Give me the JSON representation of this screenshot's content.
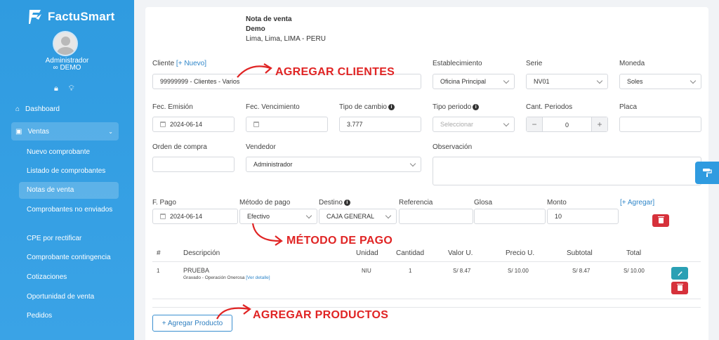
{
  "app": {
    "brand": "FactuSmart"
  },
  "user": {
    "name": "Administrador",
    "role": "DEMO"
  },
  "sidebar": {
    "dashboard": "Dashboard",
    "ventas": "Ventas",
    "sub": [
      "Nuevo comprobante",
      "Listado de comprobantes",
      "Notas de venta",
      "Comprobantes no enviados",
      "CPE por rectificar",
      "Comprobante contingencia",
      "Cotizaciones",
      "Oportunidad de venta",
      "Pedidos"
    ],
    "active": "Notas de venta"
  },
  "company": {
    "doc_type": "Nota de venta",
    "name": "Demo",
    "address": "Lima, Lima, LIMA - PERU"
  },
  "form": {
    "cliente_label": "Cliente",
    "cliente_new": "[+ Nuevo]",
    "cliente_value": "99999999 - Clientes - Varios",
    "establecimiento_label": "Establecimiento",
    "establecimiento_value": "Oficina Principal",
    "serie_label": "Serie",
    "serie_value": "NV01",
    "moneda_label": "Moneda",
    "moneda_value": "Soles",
    "fec_emision_label": "Fec. Emisión",
    "fec_emision_value": "2024-06-14",
    "fec_venc_label": "Fec. Vencimiento",
    "tipo_cambio_label": "Tipo de cambio",
    "tipo_cambio_value": "3.777",
    "tipo_periodo_label": "Tipo periodo",
    "tipo_periodo_placeholder": "Seleccionar",
    "cant_periodos_label": "Cant. Periodos",
    "cant_periodos_value": "0",
    "placa_label": "Placa",
    "orden_label": "Orden de compra",
    "vendedor_label": "Vendedor",
    "vendedor_value": "Administrador",
    "observacion_label": "Observación"
  },
  "payment": {
    "f_pago_label": "F. Pago",
    "f_pago_value": "2024-06-14",
    "metodo_label": "Método de pago",
    "metodo_value": "Efectivo",
    "destino_label": "Destino",
    "destino_value": "CAJA GENERAL",
    "referencia_label": "Referencia",
    "glosa_label": "Glosa",
    "monto_label": "Monto",
    "monto_value": "10",
    "agregar_link": "[+ Agregar]"
  },
  "table": {
    "headers": [
      "#",
      "Descripción",
      "Unidad",
      "Cantidad",
      "Valor U.",
      "Precio U.",
      "Subtotal",
      "Total"
    ],
    "rows": [
      {
        "num": "1",
        "desc": "PRUEBA",
        "desc_sub": "Gravado - Operación Onerosa",
        "detail_link": "[Ver detalle]",
        "unidad": "NIU",
        "cantidad": "1",
        "valor": "S/ 8.47",
        "precio": "S/ 10.00",
        "subtotal": "S/ 8.47",
        "total": "S/ 10.00"
      }
    ]
  },
  "buttons": {
    "add_product": "+ Agregar Producto"
  },
  "annotations": {
    "clientes": "AGREGAR CLIENTES",
    "metodo": "MÉTODO DE PAGO",
    "productos": "AGREGAR PRODUCTOS"
  },
  "colors": {
    "sidebar": "#3aa3e6",
    "annotation": "#e02424",
    "danger": "#d6313b",
    "info": "#2aa0b4",
    "link": "#2f86c9"
  }
}
